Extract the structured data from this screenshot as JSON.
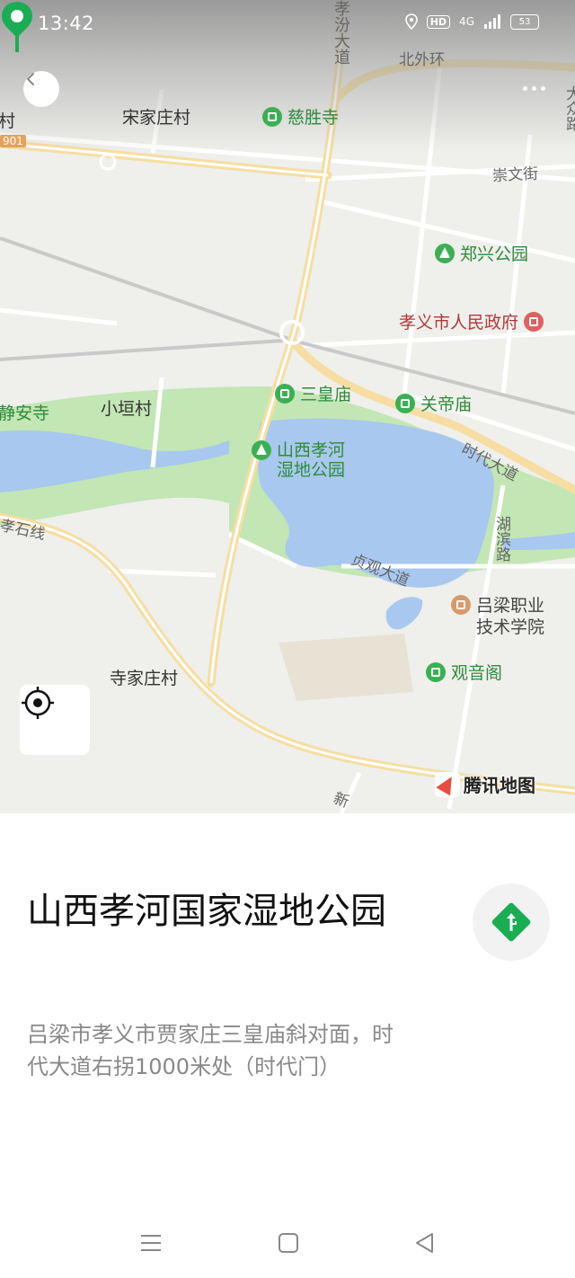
{
  "status": {
    "time": "13:42",
    "hd": "HD",
    "network": "4G",
    "battery": "53"
  },
  "map": {
    "labels": {
      "xiaofen_avenue": "孝汾大道",
      "beiwaihuan": "北外环",
      "songjiazhuang": "宋家庄村",
      "cishengsi": "慈胜寺",
      "chongwenjie": "崇文街",
      "zhengxing_park": "郑兴公园",
      "gov": "孝义市人民政府",
      "jingansi": "静安寺",
      "xiaoyuancun": "小垣村",
      "sanhuangmiao": "三皇庙",
      "guandimiao": "关帝庙",
      "wetland_l1": "山西孝河",
      "wetland_l2": "湿地公园",
      "shidai_avenue": "时代大道",
      "xiaoshixian": "孝石线",
      "hubinlu": "湖滨路",
      "zhenguan_avenue": "贞观大道",
      "lvliang_l1": "吕梁职业",
      "lvliang_l2": "技术学院",
      "guanyinge": "观音阁",
      "sijiazhuang": "寺家庄村",
      "xin": "新",
      "dazhong": "大众路",
      "cun_left": "村",
      "road_901": "901"
    },
    "logo_text": "腾讯地图"
  },
  "place": {
    "name": "山西孝河国家湿地公园",
    "address": "吕梁市孝义市贾家庄三皇庙斜对面，时代大道右拐1000米处（时代门）"
  },
  "colors": {
    "accent": "#1aad53",
    "water": "#a8c8ef",
    "park": "#bfe6b1",
    "road": "#ffffff",
    "major_road": "#f5dfa0"
  }
}
